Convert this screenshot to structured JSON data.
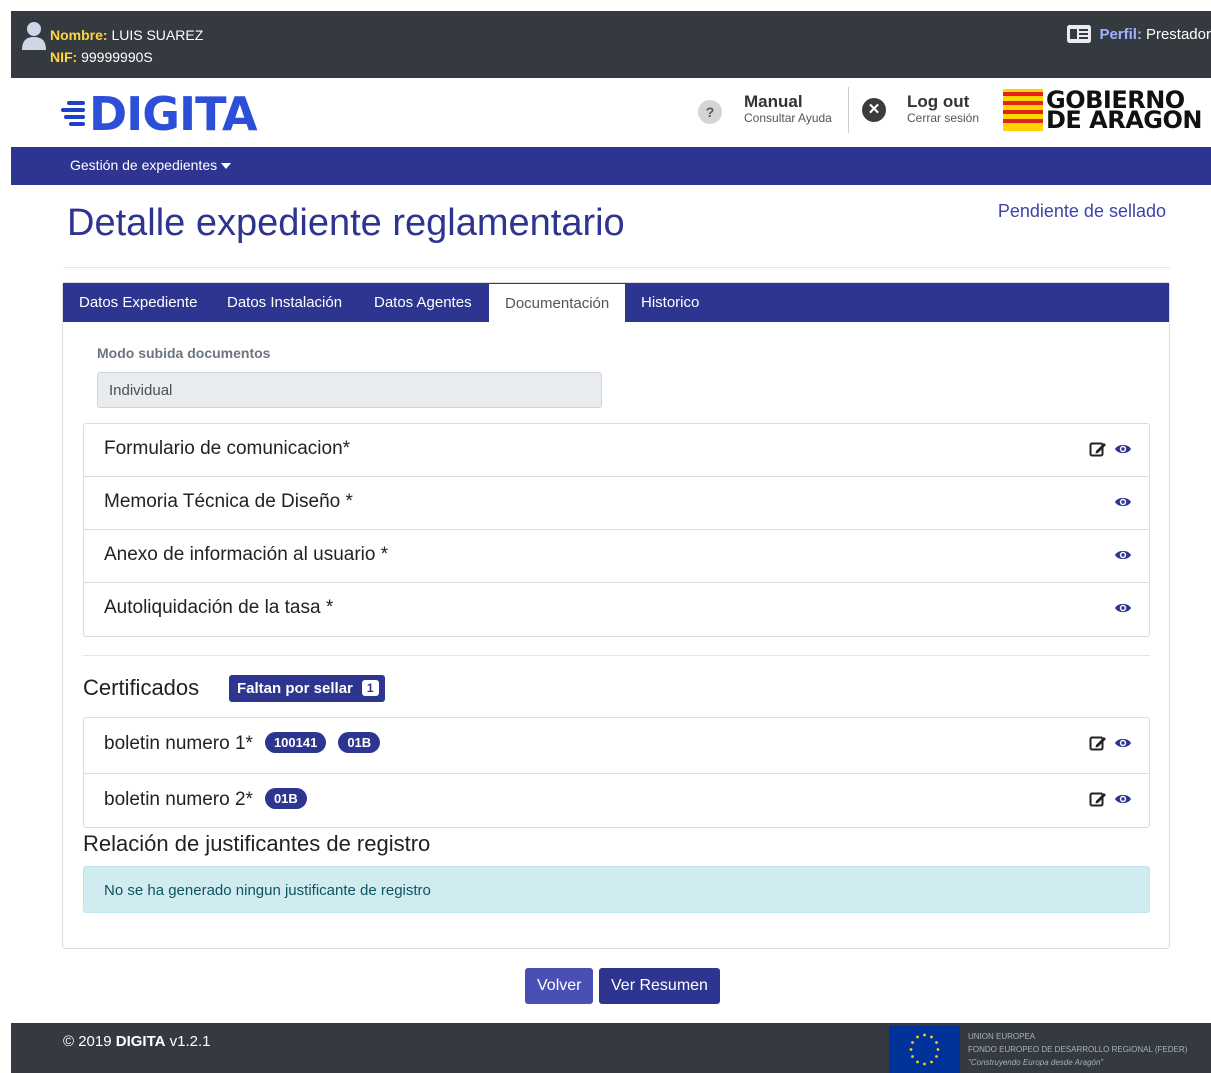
{
  "userbar": {
    "name_key": "Nombre:",
    "name_value": "LUIS SUAREZ",
    "nif_key": "NIF:",
    "nif_value": "99999990S",
    "perfil_key": "Perfil:",
    "perfil_value": "Prestador"
  },
  "header": {
    "logo": "DIGITA",
    "manual_title": "Manual",
    "manual_subtitle": "Consultar Ayuda",
    "logout_title": "Log out",
    "logout_subtitle": "Cerrar sesión",
    "gov_line1": "GOBIERNO",
    "gov_line2": "DE ARAGON",
    "help_glyph": "?",
    "close_glyph": "✕"
  },
  "nav": {
    "menu_label": "Gestión de expedientes"
  },
  "page": {
    "title": "Detalle expediente reglamentario",
    "status": "Pendiente de sellado"
  },
  "tabs": [
    {
      "label": "Datos Expediente",
      "active": false
    },
    {
      "label": "Datos Instalación",
      "active": false
    },
    {
      "label": "Datos Agentes",
      "active": false
    },
    {
      "label": "Documentación",
      "active": true
    },
    {
      "label": "Historico",
      "active": false
    }
  ],
  "upload_mode": {
    "label": "Modo subida documentos",
    "value": "Individual"
  },
  "documents": [
    {
      "label": "Formulario de comunicacion*",
      "icons": [
        "edit-icon",
        "eye-icon"
      ]
    },
    {
      "label": "Memoria Técnica de Diseño *",
      "icons": [
        "eye-icon"
      ]
    },
    {
      "label": "Anexo de información al usuario *",
      "icons": [
        "eye-icon"
      ]
    },
    {
      "label": "Autoliquidación de la tasa *",
      "icons": [
        "eye-icon"
      ]
    }
  ],
  "certificados": {
    "title": "Certificados",
    "badge_label": "Faltan por sellar",
    "badge_count": "1",
    "items": [
      {
        "label": "boletin numero 1*",
        "pills": [
          "100141",
          "01B"
        ],
        "icons": [
          "edit-icon",
          "eye-icon"
        ]
      },
      {
        "label": "boletin numero 2*",
        "pills": [
          "01B"
        ],
        "icons": [
          "edit-icon",
          "eye-icon"
        ]
      }
    ]
  },
  "justificantes": {
    "title": "Relación de justificantes de registro",
    "empty_message": "No se ha generado ningun justificante de registro"
  },
  "buttons": {
    "volver": "Volver",
    "resumen": "Ver Resumen"
  },
  "footer": {
    "copyright_prefix": "© 2019",
    "brand": "DIGITA",
    "version": "v1.2.1",
    "eu_line1": "UNION EUROPEA",
    "eu_line2": "FONDO EUROPEO DE DESARROLLO REGIONAL (FEDER)",
    "eu_line3": "\"Construyendo Europa desde Aragón\""
  },
  "colors": {
    "primary": "#2e3590",
    "dark_bar": "#343a40",
    "alert_bg": "#d1ecf1",
    "status_text": "#3d44a8",
    "name_key": "#ffd43b"
  }
}
